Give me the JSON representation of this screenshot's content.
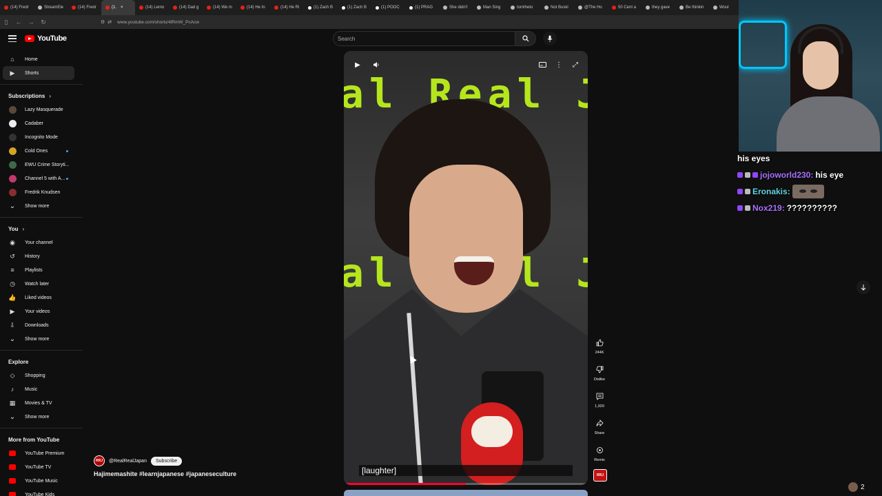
{
  "browser": {
    "tabs": [
      {
        "label": "(14) Fredr",
        "icon": "yt"
      },
      {
        "label": "StreamEle",
        "icon": "tw"
      },
      {
        "label": "(14) Fredr",
        "icon": "yt"
      },
      {
        "label": "(1.",
        "icon": "yt",
        "active": true
      },
      {
        "label": "(14) Lemo",
        "icon": "yt"
      },
      {
        "label": "(14) Dad g",
        "icon": "yt"
      },
      {
        "label": "(14) We m",
        "icon": "yt"
      },
      {
        "label": "(14) He In",
        "icon": "yt"
      },
      {
        "label": "(14) He Ri",
        "icon": "yt"
      },
      {
        "label": "(1) Zach B",
        "icon": "x"
      },
      {
        "label": "(1) Zach B",
        "icon": "x"
      },
      {
        "label": "(1) POOC",
        "icon": "x"
      },
      {
        "label": "(1) PRAG",
        "icon": "x"
      },
      {
        "label": "She didn't",
        "icon": "tw"
      },
      {
        "label": "Man Sing",
        "icon": "tw"
      },
      {
        "label": "tomtheto",
        "icon": "tw"
      },
      {
        "label": "Not Buski",
        "icon": "tw"
      },
      {
        "label": "@The Ho",
        "icon": "tw"
      },
      {
        "label": "50 Cent a",
        "icon": "yt"
      },
      {
        "label": "they gave",
        "icon": "tw"
      },
      {
        "label": "Be thinkin",
        "icon": "tw"
      },
      {
        "label": "Woul",
        "icon": "tw"
      }
    ],
    "url": "www.youtube.com/shorts/4lRmW_PcAcw"
  },
  "youtube": {
    "logo_text": "YouTube",
    "search_placeholder": "Search"
  },
  "sidebar": {
    "main": [
      {
        "label": "Home",
        "icon": "home-icon"
      },
      {
        "label": "Shorts",
        "icon": "shorts-icon",
        "active": true
      }
    ],
    "subscriptions_header": "Subscriptions",
    "subscriptions": [
      {
        "label": "Lazy Masquerade",
        "color": "#5a4a3a"
      },
      {
        "label": "Cadaber",
        "color": "#ececec"
      },
      {
        "label": "Incognito Mode",
        "color": "#333333"
      },
      {
        "label": "Cold Ones",
        "color": "#d6a425",
        "dot": true
      },
      {
        "label": "EWU Crime Storyti...",
        "color": "#3d6b4a"
      },
      {
        "label": "Channel 5 with A...",
        "color": "#c23a6a",
        "dot": true
      },
      {
        "label": "Fredrik Knudsen",
        "color": "#8a2d2d"
      }
    ],
    "show_more": "Show more",
    "you_header": "You",
    "you": [
      {
        "label": "Your channel",
        "icon": "channel-icon"
      },
      {
        "label": "History",
        "icon": "history-icon"
      },
      {
        "label": "Playlists",
        "icon": "playlists-icon"
      },
      {
        "label": "Watch later",
        "icon": "clock-icon"
      },
      {
        "label": "Liked videos",
        "icon": "thumbs-up-icon"
      },
      {
        "label": "Your videos",
        "icon": "play-icon"
      },
      {
        "label": "Downloads",
        "icon": "download-icon"
      }
    ],
    "explore_header": "Explore",
    "explore": [
      {
        "label": "Shopping",
        "icon": "bag-icon"
      },
      {
        "label": "Music",
        "icon": "music-icon"
      },
      {
        "label": "Movies & TV",
        "icon": "film-icon"
      }
    ],
    "more_header": "More from YouTube",
    "more": [
      {
        "label": "YouTube Premium"
      },
      {
        "label": "YouTube TV"
      },
      {
        "label": "YouTube Music"
      },
      {
        "label": "YouTube Kids"
      }
    ]
  },
  "video": {
    "sign_text": "al Real Jap",
    "caption": "[laughter]",
    "progress": 0.5,
    "channel_handle": "@RealRealJapan",
    "channel_badge": "RRJ",
    "subscribe_label": "Subscribe",
    "title": "Hajimemashite #learnjapanese #japaneseculture",
    "likes": "244K",
    "dislike_label": "Dislike",
    "comments": "1,920",
    "share_label": "Share",
    "remix_label": "Remix"
  },
  "stream": {
    "chat": [
      {
        "user": "",
        "message": "his eyes"
      },
      {
        "user": "jojoworld230:",
        "message": "his eye",
        "color": "#a970ff"
      },
      {
        "user": "Eronakis:",
        "message": "",
        "emote": true,
        "color": "#5fd3e0"
      },
      {
        "user": "Nox219:",
        "message": "??????????",
        "color": "#a970ff"
      }
    ],
    "viewer_count": "2"
  }
}
